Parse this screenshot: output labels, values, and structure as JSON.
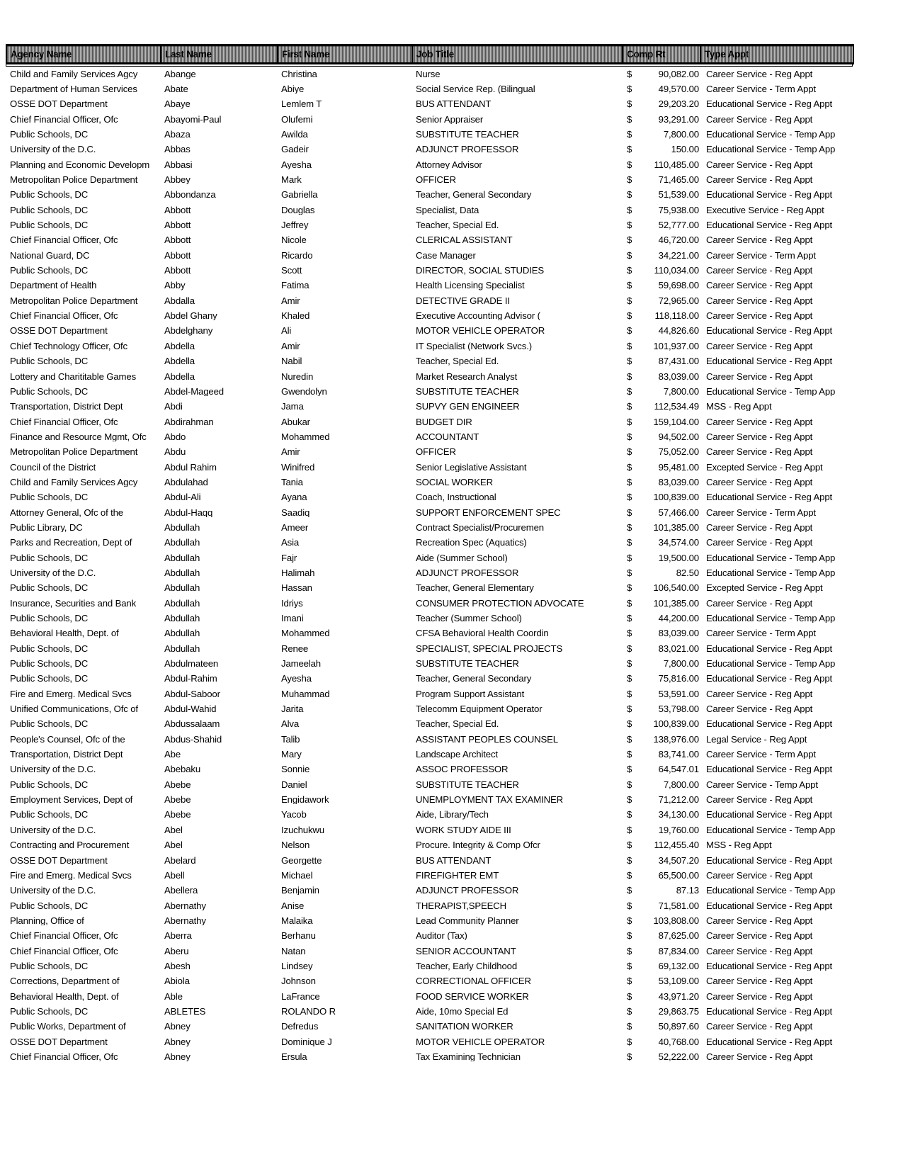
{
  "document": {
    "type": "spreadsheet-printout",
    "columns": [
      {
        "key": "agency",
        "label": "Agency Name"
      },
      {
        "key": "last",
        "label": "Last Name"
      },
      {
        "key": "first",
        "label": "First Name"
      },
      {
        "key": "job",
        "label": "Job Title"
      },
      {
        "key": "comp",
        "label": "Comp Rt"
      },
      {
        "key": "type",
        "label": "Type Appt"
      }
    ],
    "currency_symbol": "$"
  },
  "table": {
    "headers": {
      "agency": "Agency Name",
      "last": "Last Name",
      "first": "First Name",
      "job": "Job Title",
      "comp": "Comp Rt",
      "type": "Type Appt"
    },
    "rows": [
      {
        "agency": "Child and Family Services Agcy",
        "last": "Abange",
        "first": "Christina",
        "job": "Nurse",
        "comp": "90,082.00",
        "type": "Career Service - Reg Appt"
      },
      {
        "agency": "Department of Human Services",
        "last": "Abate",
        "first": "Abiye",
        "job": "Social Service Rep. (Bilingual",
        "comp": "49,570.00",
        "type": "Career Service - Term Appt"
      },
      {
        "agency": "OSSE DOT Department",
        "last": "Abaye",
        "first": "Lemlem T",
        "job": "BUS ATTENDANT",
        "comp": "29,203.20",
        "type": "Educational Service - Reg Appt"
      },
      {
        "agency": "Chief Financial Officer, Ofc",
        "last": "Abayomi-Paul",
        "first": "Olufemi",
        "job": "Senior Appraiser",
        "comp": "93,291.00",
        "type": "Career Service - Reg Appt"
      },
      {
        "agency": "Public Schools, DC",
        "last": "Abaza",
        "first": "Awilda",
        "job": "SUBSTITUTE TEACHER",
        "comp": "7,800.00",
        "type": "Educational Service - Temp App"
      },
      {
        "agency": "University of the D.C.",
        "last": "Abbas",
        "first": "Gadeir",
        "job": "ADJUNCT PROFESSOR",
        "comp": "150.00",
        "type": "Educational Service - Temp App"
      },
      {
        "agency": "Planning and Economic Developm",
        "last": "Abbasi",
        "first": "Ayesha",
        "job": "Attorney Advisor",
        "comp": "110,485.00",
        "type": "Career Service - Reg Appt"
      },
      {
        "agency": "Metropolitan Police Department",
        "last": "Abbey",
        "first": "Mark",
        "job": "OFFICER",
        "comp": "71,465.00",
        "type": "Career Service - Reg Appt"
      },
      {
        "agency": "Public Schools, DC",
        "last": "Abbondanza",
        "first": "Gabriella",
        "job": "Teacher, General Secondary",
        "comp": "51,539.00",
        "type": "Educational Service - Reg Appt"
      },
      {
        "agency": "Public Schools, DC",
        "last": "Abbott",
        "first": "Douglas",
        "job": "Specialist, Data",
        "comp": "75,938.00",
        "type": "Executive Service - Reg Appt"
      },
      {
        "agency": "Public Schools, DC",
        "last": "Abbott",
        "first": "Jeffrey",
        "job": "Teacher, Special Ed.",
        "comp": "52,777.00",
        "type": "Educational Service - Reg Appt"
      },
      {
        "agency": "Chief Financial Officer, Ofc",
        "last": "Abbott",
        "first": "Nicole",
        "job": "CLERICAL ASSISTANT",
        "comp": "46,720.00",
        "type": "Career Service - Reg Appt"
      },
      {
        "agency": "National Guard, DC",
        "last": "Abbott",
        "first": "Ricardo",
        "job": "Case Manager",
        "comp": "34,221.00",
        "type": "Career Service - Term Appt"
      },
      {
        "agency": "Public Schools, DC",
        "last": "Abbott",
        "first": "Scott",
        "job": "DIRECTOR, SOCIAL STUDIES",
        "comp": "110,034.00",
        "type": "Career Service - Reg Appt"
      },
      {
        "agency": "Department of Health",
        "last": "Abby",
        "first": "Fatima",
        "job": "Health Licensing Specialist",
        "comp": "59,698.00",
        "type": "Career Service - Reg Appt"
      },
      {
        "agency": "Metropolitan Police Department",
        "last": "Abdalla",
        "first": "Amir",
        "job": "DETECTIVE GRADE II",
        "comp": "72,965.00",
        "type": "Career Service - Reg Appt"
      },
      {
        "agency": "Chief Financial Officer, Ofc",
        "last": "Abdel Ghany",
        "first": "Khaled",
        "job": "Executive Accounting Advisor (",
        "comp": "118,118.00",
        "type": "Career Service - Reg Appt"
      },
      {
        "agency": "OSSE DOT Department",
        "last": "Abdelghany",
        "first": "Ali",
        "job": "MOTOR VEHICLE OPERATOR",
        "comp": "44,826.60",
        "type": "Educational Service - Reg Appt"
      },
      {
        "agency": "Chief Technology Officer, Ofc",
        "last": "Abdella",
        "first": "Amir",
        "job": "IT Specialist (Network Svcs.)",
        "comp": "101,937.00",
        "type": "Career Service - Reg Appt"
      },
      {
        "agency": "Public Schools, DC",
        "last": "Abdella",
        "first": "Nabil",
        "job": "Teacher, Special Ed.",
        "comp": "87,431.00",
        "type": "Educational Service - Reg Appt"
      },
      {
        "agency": "Lottery and Charititable Games",
        "last": "Abdella",
        "first": "Nuredin",
        "job": "Market Research Analyst",
        "comp": "83,039.00",
        "type": "Career Service - Reg Appt"
      },
      {
        "agency": "Public Schools, DC",
        "last": "Abdel-Mageed",
        "first": "Gwendolyn",
        "job": "SUBSTITUTE TEACHER",
        "comp": "7,800.00",
        "type": "Educational Service - Temp App"
      },
      {
        "agency": "Transportation, District Dept",
        "last": "Abdi",
        "first": "Jama",
        "job": "SUPVY GEN ENGINEER",
        "comp": "112,534.49",
        "type": "MSS - Reg Appt"
      },
      {
        "agency": "Chief Financial Officer, Ofc",
        "last": "Abdirahman",
        "first": "Abukar",
        "job": "BUDGET DIR",
        "comp": "159,104.00",
        "type": "Career Service - Reg Appt"
      },
      {
        "agency": "Finance and Resource Mgmt, Ofc",
        "last": "Abdo",
        "first": "Mohammed",
        "job": "ACCOUNTANT",
        "comp": "94,502.00",
        "type": "Career Service - Reg Appt"
      },
      {
        "agency": "Metropolitan Police Department",
        "last": "Abdu",
        "first": "Amir",
        "job": "OFFICER",
        "comp": "75,052.00",
        "type": "Career Service - Reg Appt"
      },
      {
        "agency": "Council of the District",
        "last": "Abdul Rahim",
        "first": "Winifred",
        "job": "Senior Legislative Assistant",
        "comp": "95,481.00",
        "type": "Excepted Service - Reg Appt"
      },
      {
        "agency": "Child and Family Services Agcy",
        "last": "Abdulahad",
        "first": "Tania",
        "job": "SOCIAL WORKER",
        "comp": "83,039.00",
        "type": "Career Service - Reg Appt"
      },
      {
        "agency": "Public Schools, DC",
        "last": "Abdul-Ali",
        "first": "Ayana",
        "job": "Coach, Instructional",
        "comp": "100,839.00",
        "type": "Educational Service - Reg Appt"
      },
      {
        "agency": "Attorney General, Ofc of the",
        "last": "Abdul-Haqq",
        "first": "Saadiq",
        "job": "SUPPORT ENFORCEMENT SPEC",
        "comp": "57,466.00",
        "type": "Career Service - Term Appt"
      },
      {
        "agency": "Public Library, DC",
        "last": "Abdullah",
        "first": "Ameer",
        "job": "Contract Specialist/Procuremen",
        "comp": "101,385.00",
        "type": "Career Service - Reg Appt"
      },
      {
        "agency": "Parks and Recreation, Dept of",
        "last": "Abdullah",
        "first": "Asia",
        "job": "Recreation Spec (Aquatics)",
        "comp": "34,574.00",
        "type": "Career Service - Reg Appt"
      },
      {
        "agency": "Public Schools, DC",
        "last": "Abdullah",
        "first": "Fajr",
        "job": "Aide (Summer School)",
        "comp": "19,500.00",
        "type": "Educational Service - Temp App"
      },
      {
        "agency": "University of the D.C.",
        "last": "Abdullah",
        "first": "Halimah",
        "job": "ADJUNCT PROFESSOR",
        "comp": "82.50",
        "type": "Educational Service - Temp App"
      },
      {
        "agency": "Public Schools, DC",
        "last": "Abdullah",
        "first": "Hassan",
        "job": "Teacher, General Elementary",
        "comp": "106,540.00",
        "type": "Excepted Service - Reg Appt"
      },
      {
        "agency": "Insurance, Securities and Bank",
        "last": "Abdullah",
        "first": "Idriys",
        "job": "CONSUMER PROTECTION ADVOCATE",
        "comp": "101,385.00",
        "type": "Career Service - Reg Appt"
      },
      {
        "agency": "Public Schools, DC",
        "last": "Abdullah",
        "first": "Imani",
        "job": "Teacher (Summer School)",
        "comp": "44,200.00",
        "type": "Educational Service - Temp App"
      },
      {
        "agency": "Behavioral Health, Dept. of",
        "last": "Abdullah",
        "first": "Mohammed",
        "job": "CFSA Behavioral Health Coordin",
        "comp": "83,039.00",
        "type": "Career Service - Term Appt"
      },
      {
        "agency": "Public Schools, DC",
        "last": "Abdullah",
        "first": "Renee",
        "job": "SPECIALIST, SPECIAL PROJECTS",
        "comp": "83,021.00",
        "type": "Educational Service - Reg Appt"
      },
      {
        "agency": "Public Schools, DC",
        "last": "Abdulmateen",
        "first": "Jameelah",
        "job": "SUBSTITUTE TEACHER",
        "comp": "7,800.00",
        "type": "Educational Service - Temp App"
      },
      {
        "agency": "Public Schools, DC",
        "last": "Abdul-Rahim",
        "first": "Ayesha",
        "job": "Teacher, General Secondary",
        "comp": "75,816.00",
        "type": "Educational Service - Reg Appt"
      },
      {
        "agency": "Fire and Emerg. Medical Svcs",
        "last": "Abdul-Saboor",
        "first": "Muhammad",
        "job": "Program Support Assistant",
        "comp": "53,591.00",
        "type": "Career Service - Reg Appt"
      },
      {
        "agency": "Unified Communications, Ofc of",
        "last": "Abdul-Wahid",
        "first": "Jarita",
        "job": "Telecomm Equipment Operator",
        "comp": "53,798.00",
        "type": "Career Service - Reg Appt"
      },
      {
        "agency": "Public Schools, DC",
        "last": "Abdussalaam",
        "first": "Alva",
        "job": "Teacher, Special Ed.",
        "comp": "100,839.00",
        "type": "Educational Service - Reg Appt"
      },
      {
        "agency": "People's Counsel, Ofc of the",
        "last": "Abdus-Shahid",
        "first": "Talib",
        "job": "ASSISTANT PEOPLES COUNSEL",
        "comp": "138,976.00",
        "type": "Legal Service - Reg Appt"
      },
      {
        "agency": "Transportation, District Dept",
        "last": "Abe",
        "first": "Mary",
        "job": "Landscape Architect",
        "comp": "83,741.00",
        "type": "Career Service - Term Appt"
      },
      {
        "agency": "University of the D.C.",
        "last": "Abebaku",
        "first": "Sonnie",
        "job": "ASSOC PROFESSOR",
        "comp": "64,547.01",
        "type": "Educational Service - Reg Appt"
      },
      {
        "agency": "Public Schools, DC",
        "last": "Abebe",
        "first": "Daniel",
        "job": "SUBSTITUTE TEACHER",
        "comp": "7,800.00",
        "type": "Career Service - Temp Appt"
      },
      {
        "agency": "Employment Services, Dept of",
        "last": "Abebe",
        "first": "Engidawork",
        "job": "UNEMPLOYMENT TAX EXAMINER",
        "comp": "71,212.00",
        "type": "Career Service - Reg Appt"
      },
      {
        "agency": "Public Schools, DC",
        "last": "Abebe",
        "first": "Yacob",
        "job": "Aide, Library/Tech",
        "comp": "34,130.00",
        "type": "Educational Service - Reg Appt"
      },
      {
        "agency": "University of the D.C.",
        "last": "Abel",
        "first": "Izuchukwu",
        "job": "WORK STUDY AIDE III",
        "comp": "19,760.00",
        "type": "Educational Service - Temp App"
      },
      {
        "agency": "Contracting and Procurement",
        "last": "Abel",
        "first": "Nelson",
        "job": "Procure. Integrity & Comp Ofcr",
        "comp": "112,455.40",
        "type": "MSS - Reg Appt"
      },
      {
        "agency": "OSSE DOT Department",
        "last": "Abelard",
        "first": "Georgette",
        "job": "BUS ATTENDANT",
        "comp": "34,507.20",
        "type": "Educational Service - Reg Appt"
      },
      {
        "agency": "Fire and Emerg. Medical Svcs",
        "last": "Abell",
        "first": "Michael",
        "job": "FIREFIGHTER EMT",
        "comp": "65,500.00",
        "type": "Career Service - Reg Appt"
      },
      {
        "agency": "University of the D.C.",
        "last": "Abellera",
        "first": "Benjamin",
        "job": "ADJUNCT PROFESSOR",
        "comp": "87.13",
        "type": "Educational Service - Temp App"
      },
      {
        "agency": "Public Schools, DC",
        "last": "Abernathy",
        "first": "Anise",
        "job": "THERAPIST,SPEECH",
        "comp": "71,581.00",
        "type": "Educational Service - Reg Appt"
      },
      {
        "agency": "Planning, Office of",
        "last": "Abernathy",
        "first": "Malaika",
        "job": "Lead Community Planner",
        "comp": "103,808.00",
        "type": "Career Service - Reg Appt"
      },
      {
        "agency": "Chief Financial Officer, Ofc",
        "last": "Aberra",
        "first": "Berhanu",
        "job": "Auditor (Tax)",
        "comp": "87,625.00",
        "type": "Career Service - Reg Appt"
      },
      {
        "agency": "Chief Financial Officer, Ofc",
        "last": "Aberu",
        "first": "Natan",
        "job": "SENIOR ACCOUNTANT",
        "comp": "87,834.00",
        "type": "Career Service - Reg Appt"
      },
      {
        "agency": "Public Schools, DC",
        "last": "Abesh",
        "first": "Lindsey",
        "job": "Teacher, Early Childhood",
        "comp": "69,132.00",
        "type": "Educational Service - Reg Appt"
      },
      {
        "agency": "Corrections, Department of",
        "last": "Abiola",
        "first": "Johnson",
        "job": "CORRECTIONAL OFFICER",
        "comp": "53,109.00",
        "type": "Career Service - Reg Appt"
      },
      {
        "agency": "Behavioral Health, Dept. of",
        "last": "Able",
        "first": "LaFrance",
        "job": "FOOD SERVICE WORKER",
        "comp": "43,971.20",
        "type": "Career Service - Reg Appt"
      },
      {
        "agency": "Public Schools, DC",
        "last": "ABLETES",
        "first": "ROLANDO R",
        "job": "Aide, 10mo Special Ed",
        "comp": "29,863.75",
        "type": "Educational Service - Reg Appt"
      },
      {
        "agency": "Public Works, Department of",
        "last": "Abney",
        "first": "Defredus",
        "job": "SANITATION WORKER",
        "comp": "50,897.60",
        "type": "Career Service - Reg Appt"
      },
      {
        "agency": "OSSE DOT Department",
        "last": "Abney",
        "first": "Dominique J",
        "job": "MOTOR VEHICLE OPERATOR",
        "comp": "40,768.00",
        "type": "Educational Service - Reg Appt"
      },
      {
        "agency": "Chief Financial Officer, Ofc",
        "last": "Abney",
        "first": "Ersula",
        "job": "Tax Examining Technician",
        "comp": "52,222.00",
        "type": "Career Service - Reg Appt"
      }
    ]
  }
}
